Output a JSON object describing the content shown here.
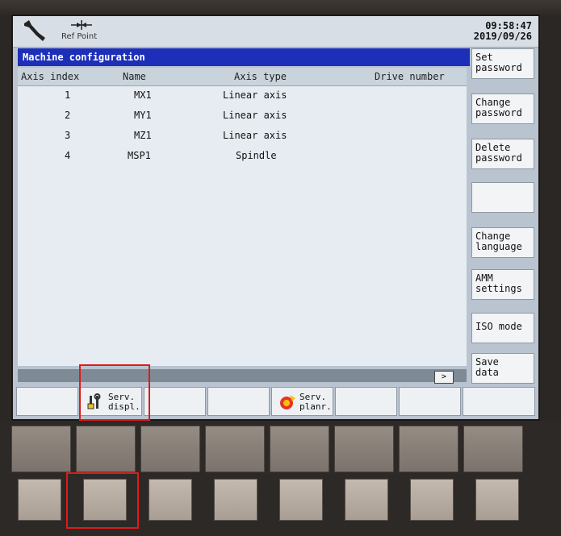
{
  "header": {
    "ref_point_label": "Ref Point",
    "time": "09:58:47",
    "date": "2019/09/26"
  },
  "title": "Machine configuration",
  "table": {
    "columns": [
      "Axis index",
      "Name",
      "Axis type",
      "Drive number"
    ],
    "rows": [
      {
        "index": "1",
        "name": "MX1",
        "type": "Linear axis"
      },
      {
        "index": "2",
        "name": "MY1",
        "type": "Linear axis"
      },
      {
        "index": "3",
        "name": "MZ1",
        "type": "Linear axis"
      },
      {
        "index": "4",
        "name": "MSP1",
        "type": "Spindle"
      }
    ]
  },
  "scroll_arrow": ">",
  "right_softkeys": [
    {
      "l1": "Set",
      "l2": "password"
    },
    {
      "l1": "Change",
      "l2": "password"
    },
    {
      "l1": "Delete",
      "l2": "password"
    },
    {
      "l1": "",
      "l2": ""
    },
    {
      "l1": "Change",
      "l2": "language"
    },
    {
      "l1": "AMM",
      "l2": "settings"
    },
    {
      "l1": "ISO mode",
      "l2": ""
    },
    {
      "l1": "Save",
      "l2": "data"
    }
  ],
  "bottom_softkeys": {
    "serv_displ": {
      "l1": "Serv.",
      "l2": "displ."
    },
    "serv_planr": {
      "l1": "Serv.",
      "l2": "planr."
    }
  },
  "colors": {
    "title_bar": "#1d2fb8",
    "highlight": "#e01a1a"
  },
  "icons": {
    "header_left": "wrench-icon",
    "ref_point": "ref-point-icon",
    "serv_displ": "tools-icon",
    "serv_planr": "service-planner-icon"
  }
}
